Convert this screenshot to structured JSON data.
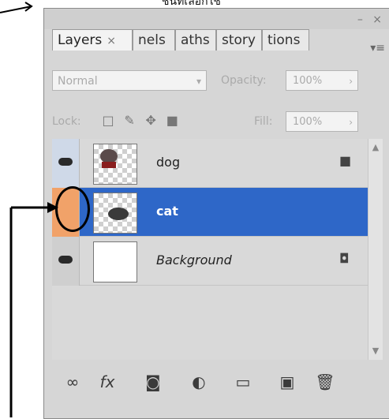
{
  "caption": "ชั้นที่เลือกใช้",
  "panel": {
    "tabs": [
      {
        "label": "Layers",
        "has_close": true
      },
      {
        "label": "nels"
      },
      {
        "label": "aths"
      },
      {
        "label": "story"
      },
      {
        "label": "tions"
      }
    ],
    "blend_mode": "Normal",
    "opacity_label": "Opacity:",
    "opacity_value": "100%",
    "lock_label": "Lock:",
    "fill_label": "Fill:",
    "fill_value": "100%"
  },
  "layers": [
    {
      "name": "dog",
      "visible": true,
      "locked": true,
      "selected": false
    },
    {
      "name": "cat",
      "visible": false,
      "locked": false,
      "selected": true
    },
    {
      "name": "Background",
      "visible": true,
      "locked": true,
      "selected": false
    }
  ],
  "colors": {
    "selection": "#2e67c8",
    "highlight_orange": "#f1a269"
  },
  "toolbar_icons": [
    "link-layers-icon",
    "fx-icon",
    "add-mask-icon",
    "adjustment-layer-icon",
    "new-group-icon",
    "new-layer-icon",
    "trash-icon"
  ]
}
